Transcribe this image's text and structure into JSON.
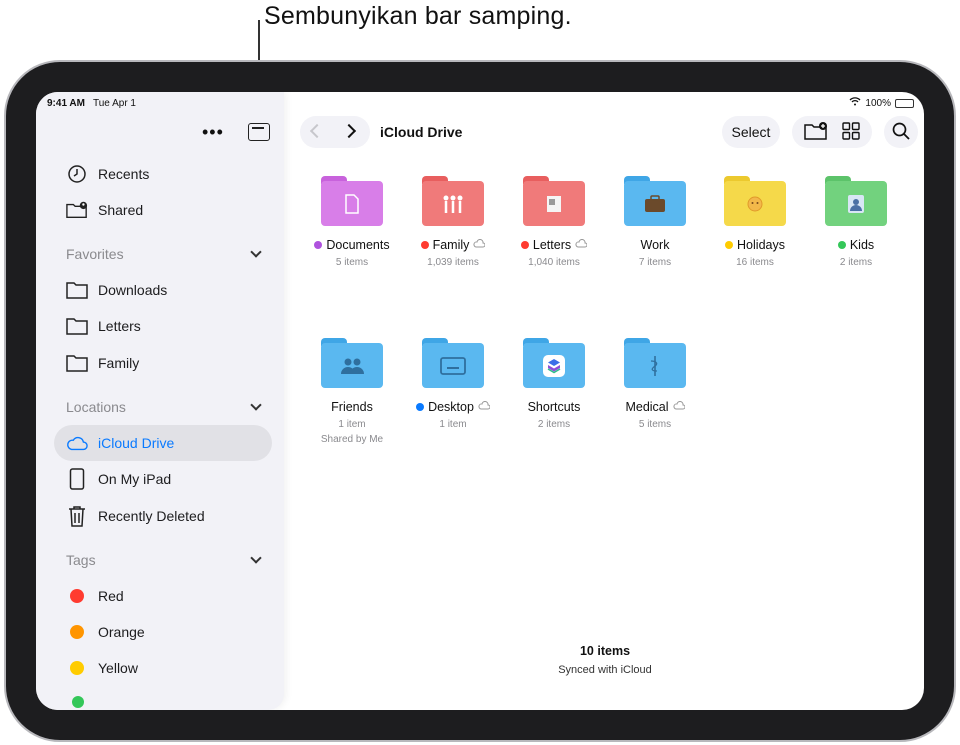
{
  "callout": "Sembunyikan bar samping.",
  "status": {
    "time": "9:41 AM",
    "date": "Tue Apr 1",
    "battery": "100%",
    "battery_level": 1.0
  },
  "sidebar": {
    "top_items": [
      {
        "label": "Recents",
        "icon": "clock-icon"
      },
      {
        "label": "Shared",
        "icon": "shared-folder-icon"
      }
    ],
    "favorites": {
      "label": "Favorites",
      "items": [
        "Downloads",
        "Letters",
        "Family"
      ]
    },
    "locations": {
      "label": "Locations",
      "items": [
        "iCloud Drive",
        "On My iPad",
        "Recently Deleted"
      ]
    },
    "tags": {
      "label": "Tags",
      "items": [
        {
          "label": "Red",
          "color": "#ff3b30"
        },
        {
          "label": "Orange",
          "color": "#ff9500"
        },
        {
          "label": "Yellow",
          "color": "#ffcc00"
        }
      ]
    }
  },
  "toolbar": {
    "title": "iCloud Drive",
    "select_label": "Select"
  },
  "folders": [
    {
      "name": "Documents",
      "meta": "5 items",
      "tag": "#af52de",
      "color": "#d87ee8",
      "glyph": "document-icon"
    },
    {
      "name": "Family",
      "meta": "1,039 items",
      "tag": "#ff3b30",
      "color": "#f07a7a",
      "glyph": "family-icon",
      "cloud": true
    },
    {
      "name": "Letters",
      "meta": "1,040 items",
      "tag": "#ff3b30",
      "color": "#f07a7a",
      "glyph": "letter-icon",
      "cloud": true
    },
    {
      "name": "Work",
      "meta": "7 items",
      "tag": "",
      "color": "#5ab8f0",
      "glyph": "briefcase-icon"
    },
    {
      "name": "Holidays",
      "meta": "16 items",
      "tag": "#ffcc00",
      "color": "#f5d94a",
      "glyph": "sun-icon"
    },
    {
      "name": "Kids",
      "meta": "2 items",
      "tag": "#34c759",
      "color": "#72d27e",
      "glyph": "kids-icon"
    },
    {
      "name": "Friends",
      "meta": "1 item",
      "meta2": "Shared by Me",
      "tag": "",
      "color": "#5ab8f0",
      "glyph": "people-icon"
    },
    {
      "name": "Desktop",
      "meta": "1 item",
      "tag": "#0a7aff",
      "color": "#5ab8f0",
      "glyph": "desktop-icon",
      "cloud": true
    },
    {
      "name": "Shortcuts",
      "meta": "2 items",
      "tag": "",
      "color": "#5ab8f0",
      "glyph": "shortcuts-icon"
    },
    {
      "name": "Medical",
      "meta": "5 items",
      "tag": "",
      "color": "#5ab8f0",
      "glyph": "medical-icon",
      "cloud": true
    }
  ],
  "footer": {
    "count": "10 items",
    "sync": "Synced with iCloud"
  }
}
